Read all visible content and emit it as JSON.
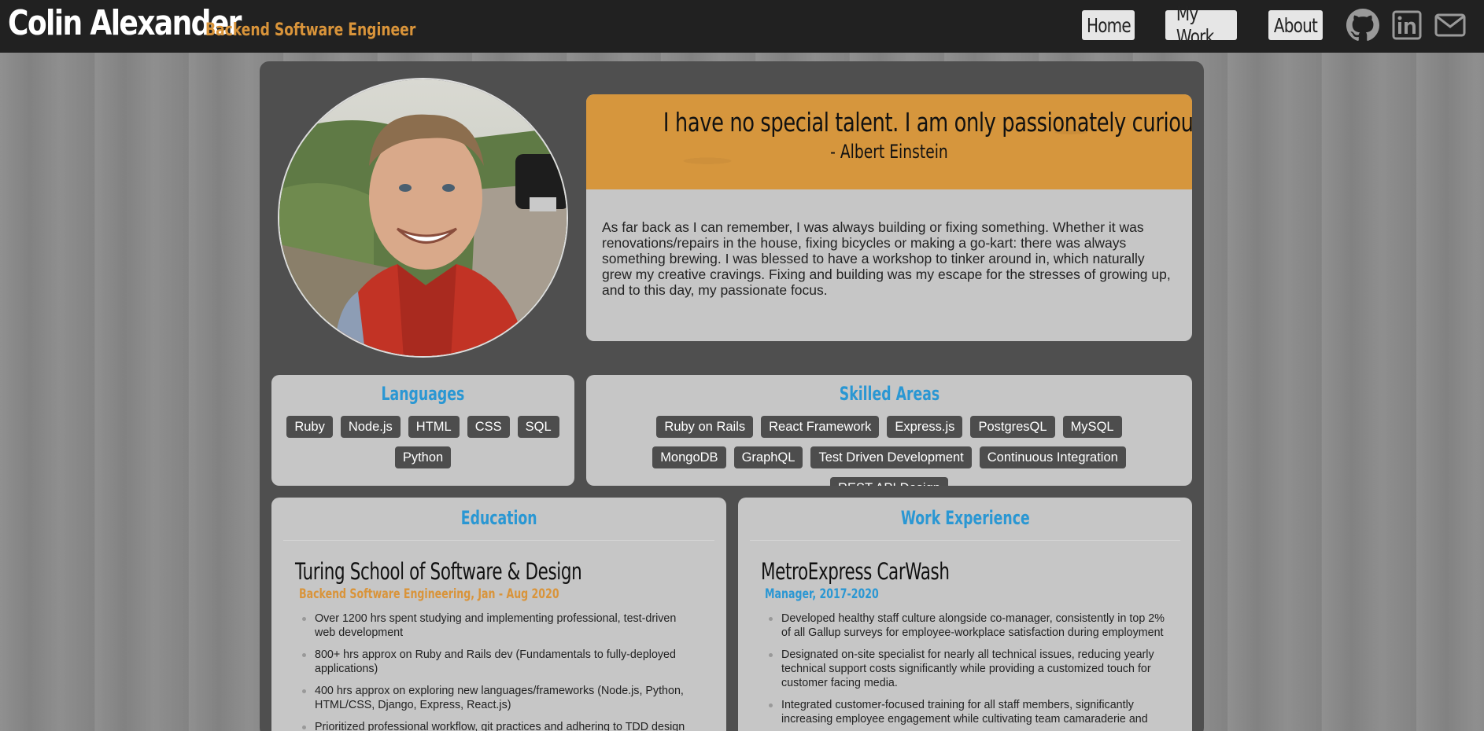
{
  "header": {
    "name": "Colin Alexander",
    "tagline": "Backend Software Engineer",
    "nav": [
      {
        "label": "Home"
      },
      {
        "label": "My Work"
      },
      {
        "label": "About"
      }
    ],
    "icons": [
      "github-icon",
      "linkedin-icon",
      "mail-icon"
    ]
  },
  "quote": {
    "text": "I have no special talent. I am only passionately curious.",
    "author": "- Albert Einstein"
  },
  "bio": "As far back as I can remember, I was always building or fixing something. Whether it was renovations/repairs in the house, fixing bicycles or making a go-kart: there was always something brewing. I was blessed to have a workshop to tinker around in, which naturally grew my creative cravings. Fixing and building was my escape for the stresses of growing up, and to this day, my passionate focus.",
  "languages": {
    "title": "Languages",
    "items": [
      "Ruby",
      "Node.js",
      "HTML",
      "CSS",
      "SQL",
      "Python"
    ]
  },
  "skills": {
    "title": "Skilled Areas",
    "items": [
      "Ruby on Rails",
      "React Framework",
      "Express.js",
      "PostgresQL",
      "MySQL",
      "MongoDB",
      "GraphQL",
      "Test Driven Development",
      "Continuous Integration",
      "REST API Design"
    ]
  },
  "education": {
    "title": "Education",
    "school": "Turing School of Software & Design",
    "program": "Backend Software Engineering, Jan - Aug 2020",
    "bullets": [
      "Over 1200 hrs spent studying and implementing professional, test-driven web development",
      "800+ hrs approx on Ruby and Rails dev (Fundamentals to fully-deployed applications)",
      "400 hrs approx on exploring new languages/frameworks (Node.js, Python, HTML/CSS, Django, Express, React.js)",
      "Prioritized professional workflow, git practices and adhering to TDD design"
    ]
  },
  "work": {
    "title": "Work Experience",
    "company": "MetroExpress CarWash",
    "role": "Manager, 2017-2020",
    "bullets": [
      "Developed healthy staff culture alongside co-manager, consistently in top 2% of all Gallup surveys for employee-workplace satisfaction during employment",
      "Designated on-site specialist for nearly all technical issues, reducing yearly technical support costs significantly while providing a customized touch for customer facing media.",
      "Integrated customer-focused training for all staff members, significantly increasing employee engagement while cultivating team camaraderie and"
    ]
  },
  "colors": {
    "accent_orange": "#d6963d",
    "accent_blue": "#2a97d3",
    "navbar": "#212121"
  }
}
